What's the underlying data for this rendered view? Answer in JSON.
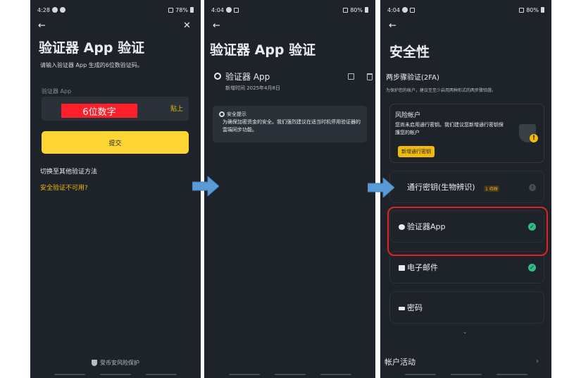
{
  "panel1": {
    "status": {
      "time": "4:28",
      "battery": "78%"
    },
    "title": "验证器 App 验证",
    "subtitle": "请输入验证器 App 生成的6位数验证码。",
    "field_label": "验证器 App",
    "code_overlay": "6位数字",
    "paste": "贴上",
    "submit": "提交",
    "switch_method": "切换至其他验证方法",
    "unavailable": "安全验证不可用?",
    "footer": "受币安风险保护"
  },
  "panel2": {
    "status": {
      "time": "4:04",
      "battery": "80%"
    },
    "title": "验证器 App 验证",
    "app_name": "验证器 App",
    "added_date": "新增时间 2025年4月8日",
    "tip_title": "安全提示",
    "tip_body": "为确保加密资金的安全。我们强烈建议在适当时机停用验证器的雲端同步功能。"
  },
  "panel3": {
    "status": {
      "time": "4:04",
      "battery": "80%"
    },
    "title": "安全性",
    "section": "两步骤验证(2FA)",
    "section_desc": "为保护您的帐户，建议至至少启用两种形式的两步骤验證。",
    "risk_title": "风险帐户",
    "risk_body": "您尚未启用通行密钥。我们建议您新增通行密钥保護您的帐户",
    "risk_button": "新增通行密钥",
    "passkey": "通行密钥(生物辨识)",
    "passkey_badge": "1 待辦",
    "authenticator": "验证器App",
    "email": "电子邮件",
    "password": "密码",
    "account_activity": "帐户活动"
  },
  "colors": {
    "bg": "#1e2329",
    "accent": "#fcd535",
    "success": "#2ebd85",
    "highlight": "#e0202e",
    "arrow": "#5b9bd5"
  }
}
